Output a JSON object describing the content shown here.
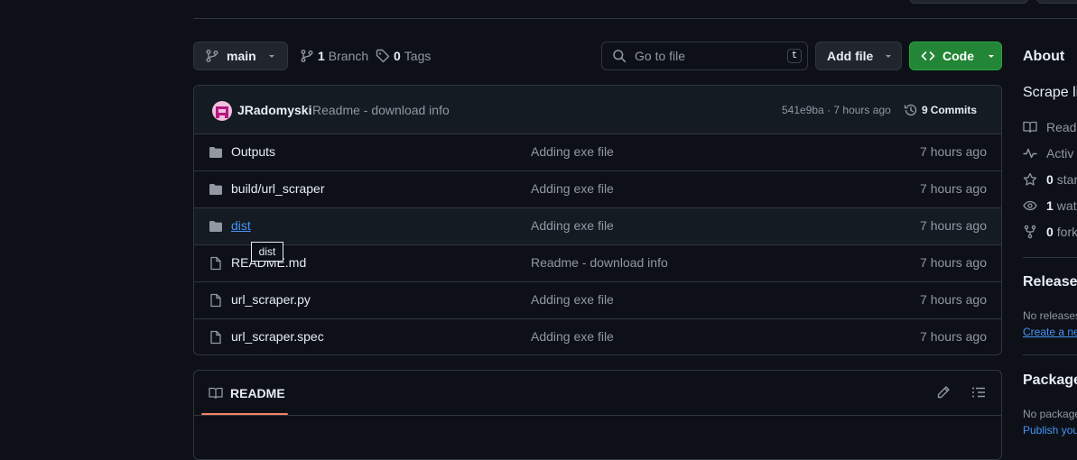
{
  "branch": {
    "current": "main",
    "branch_count": "1",
    "branch_label": "Branch",
    "tag_count": "0",
    "tag_label": "Tags"
  },
  "search": {
    "placeholder": "Go to file",
    "shortcut": "t"
  },
  "buttons": {
    "add_file": "Add file",
    "code": "Code"
  },
  "commit": {
    "author": "JRadomyski",
    "message": "Readme - download info",
    "hash": "541e9ba",
    "separator": "·",
    "time": "7 hours ago",
    "count_num": "9",
    "count_label": "Commits"
  },
  "files": [
    {
      "name": "Outputs",
      "type": "folder",
      "message": "Adding exe file",
      "time": "7 hours ago"
    },
    {
      "name": "build/url_scraper",
      "type": "folder",
      "message": "Adding exe file",
      "time": "7 hours ago"
    },
    {
      "name": "dist",
      "type": "folder",
      "message": "Adding exe file",
      "time": "7 hours ago"
    },
    {
      "name": "README.md",
      "type": "file",
      "message": "Readme - download info",
      "time": "7 hours ago"
    },
    {
      "name": "url_scraper.py",
      "type": "file",
      "message": "Adding exe file",
      "time": "7 hours ago"
    },
    {
      "name": "url_scraper.spec",
      "type": "file",
      "message": "Adding exe file",
      "time": "7 hours ago"
    }
  ],
  "tooltip": {
    "text": "dist"
  },
  "readme": {
    "title": "README"
  },
  "sidebar": {
    "about_title": "About",
    "description": "Scrape li",
    "items": [
      {
        "icon": "book-icon",
        "num": "",
        "label": "Read"
      },
      {
        "icon": "pulse-icon",
        "num": "",
        "label": "Activ"
      },
      {
        "icon": "star-icon",
        "num": "0",
        "label": "star"
      },
      {
        "icon": "eye-icon",
        "num": "1",
        "label": "wat"
      },
      {
        "icon": "fork-icon",
        "num": "0",
        "label": "fork"
      }
    ],
    "releases_title": "Releases",
    "releases_text": "No releases",
    "releases_link": "Create a ne",
    "packages_title": "Package",
    "packages_text": "No package",
    "packages_link": "Publish you"
  },
  "colors": {
    "accent_green": "#238636",
    "link": "#4493f8",
    "bg": "#0d1117",
    "border": "#30363d",
    "readme_underline": "#f78166"
  }
}
